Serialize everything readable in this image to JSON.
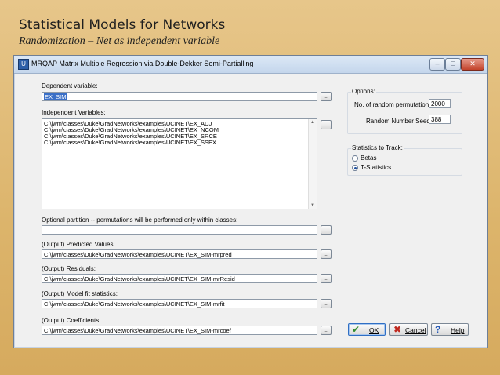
{
  "slide": {
    "title": "Statistical Models for Networks",
    "subtitle": "Randomization – Net as independent variable"
  },
  "window": {
    "title": "MRQAP Matrix Multiple Regression via Double-Dekker Semi-Partialling",
    "app_icon": "ucinet-app-icon",
    "controls": {
      "minimize": "–",
      "maximize": "□",
      "close": "✕"
    }
  },
  "dependent": {
    "label": "Dependent variable:",
    "value": "EX_SIM"
  },
  "independent": {
    "label": "Independent Variables:",
    "items": [
      "C:\\jwm\\classes\\Duke\\GradNetworks\\examples\\UCINET\\EX_ADJ",
      "C:\\jwm\\classes\\Duke\\GradNetworks\\examples\\UCINET\\EX_NCOM",
      "C:\\jwm\\classes\\Duke\\GradNetworks\\examples\\UCINET\\EX_SRCE",
      "C:\\jwm\\classes\\Duke\\GradNetworks\\examples\\UCINET\\EX_SSEX"
    ]
  },
  "partition": {
    "label": "Optional partition -- permutations will be performed only within classes:",
    "value": ""
  },
  "outputs": {
    "predicted": {
      "label": "(Output) Predicted Values:",
      "value": "C:\\jwm\\classes\\Duke\\GradNetworks\\examples\\UCINET\\EX_SIM-mrpred"
    },
    "residuals": {
      "label": "(Output) Residuals:",
      "value": "C:\\jwm\\classes\\Duke\\GradNetworks\\examples\\UCINET\\EX_SIM-mrResid"
    },
    "modelfit": {
      "label": "(Output) Model fit statistics:",
      "value": "C:\\jwm\\classes\\Duke\\GradNetworks\\examples\\UCINET\\EX_SIM-mrfit"
    },
    "coefficients": {
      "label": "(Output) Coefficients",
      "value": "C:\\jwm\\classes\\Duke\\GradNetworks\\examples\\UCINET\\EX_SIM-mrcoef"
    }
  },
  "browse_label": "...",
  "options": {
    "title": "Options:",
    "permutations_label": "No. of random permutations:",
    "permutations_value": "2000",
    "seed_label": "Random Number Seed:",
    "seed_value": "388"
  },
  "stats": {
    "title": "Statistics to Track:",
    "betas_label": "Betas",
    "tstats_label": "T-Statistics",
    "selected": "T-Statistics"
  },
  "buttons": {
    "ok": "OK",
    "cancel": "Cancel",
    "help": "Help"
  },
  "colors": {
    "ok_icon": "#2e8b2e",
    "cancel_icon": "#c0281f",
    "help_icon": "#2559b7"
  }
}
